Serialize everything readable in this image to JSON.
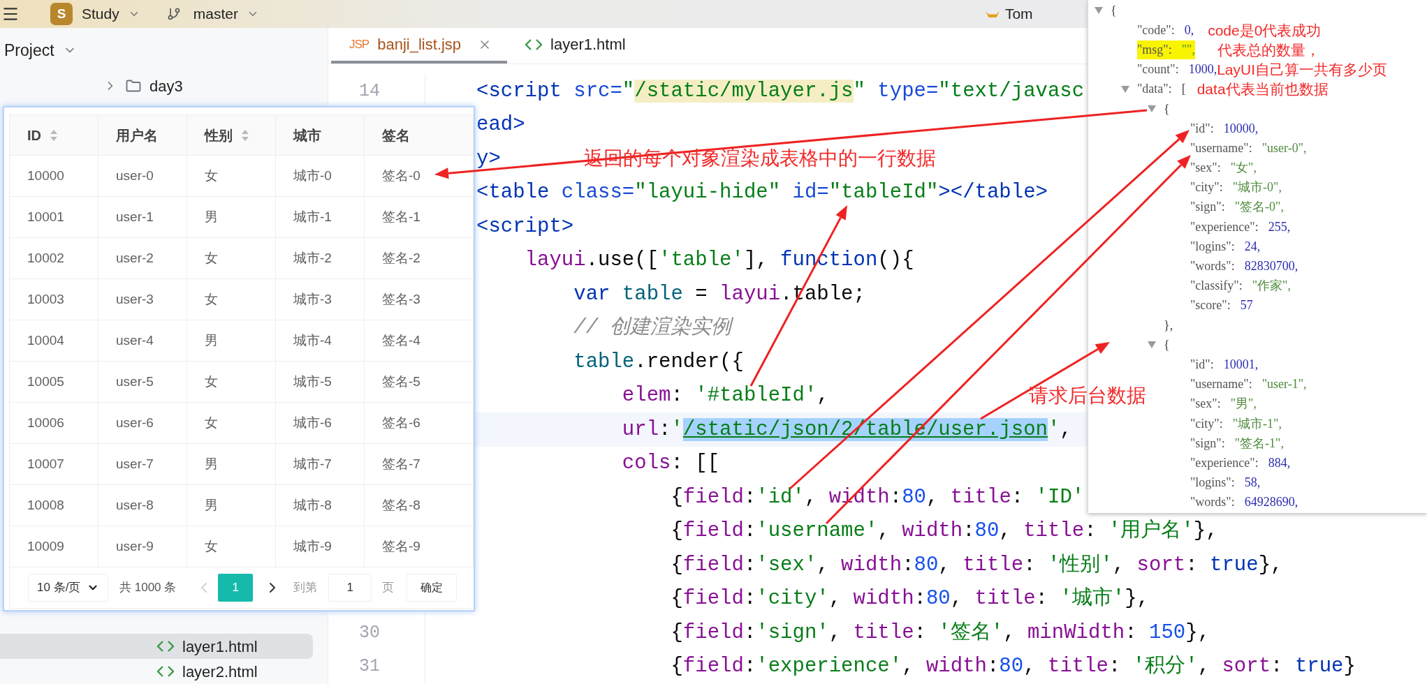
{
  "topbar": {
    "project_badge": "S",
    "project": "Study",
    "branch": "master",
    "run_config": "Tom"
  },
  "sidebar": {
    "title": "Project",
    "items_top": [
      {
        "label": "day3",
        "kind": "folder",
        "expanded": false,
        "selected": false
      }
    ],
    "items_bottom": [
      {
        "label": "layer1.html",
        "kind": "html",
        "selected": true
      },
      {
        "label": "layer2.html",
        "kind": "html",
        "selected": false
      }
    ]
  },
  "editor": {
    "tabs": [
      {
        "label": "banji_list.jsp",
        "kind": "jsp",
        "icon_text": "JSP",
        "selected": true,
        "closable": true
      },
      {
        "label": "layer1.html",
        "kind": "html",
        "selected": false,
        "closable": false
      }
    ],
    "lines": [
      {
        "number": "14",
        "current": false,
        "tokens": [
          {
            "text": "<script",
            "kind": "tag"
          },
          {
            "text": " src=",
            "kind": "attr"
          },
          {
            "text": "\"",
            "kind": "string"
          },
          {
            "text": "/static/mylayer.js",
            "kind": "string_match"
          },
          {
            "text": "\"",
            "kind": "string"
          },
          {
            "text": " type=",
            "kind": "attr"
          },
          {
            "text": "\"text/javasc",
            "kind": "string"
          }
        ]
      },
      {
        "current": false,
        "tokens": [
          {
            "text": "ead>",
            "kind": "tag"
          }
        ]
      },
      {
        "current": false,
        "tokens": [
          {
            "text": "y>",
            "kind": "tag"
          }
        ],
        "note": "返回的每个对象渲染成表格中的一行数据"
      },
      {
        "current": false,
        "tokens": [
          {
            "text": "<table",
            "kind": "tag"
          },
          {
            "text": " class=",
            "kind": "attr"
          },
          {
            "text": "\"layui-hide\"",
            "kind": "string"
          },
          {
            "text": " id=",
            "kind": "attr"
          },
          {
            "text": "\"tableId\"",
            "kind": "string"
          },
          {
            "text": "></table>",
            "kind": "tag"
          }
        ]
      },
      {
        "current": false,
        "tokens": [
          {
            "text": "<script>",
            "kind": "tag"
          }
        ]
      },
      {
        "current": false,
        "tokens": [
          {
            "text": "    layui",
            "kind": "ident"
          },
          {
            "text": ".use([",
            "kind": "plain"
          },
          {
            "text": "'table'",
            "kind": "string"
          },
          {
            "text": "], ",
            "kind": "plain"
          },
          {
            "text": "function",
            "kind": "keyword"
          },
          {
            "text": "(){",
            "kind": "plain"
          }
        ]
      },
      {
        "current": false,
        "tokens": [
          {
            "text": "        var",
            "kind": "keyword"
          },
          {
            "text": " table",
            "kind": "variable"
          },
          {
            "text": " = ",
            "kind": "plain"
          },
          {
            "text": "layui",
            "kind": "ident"
          },
          {
            "text": ".table;",
            "kind": "plain"
          }
        ]
      },
      {
        "current": false,
        "tokens": [
          {
            "text": "        // 创建渲染实例",
            "kind": "comment"
          }
        ]
      },
      {
        "current": false,
        "tokens": [
          {
            "text": "        table",
            "kind": "variable"
          },
          {
            "text": ".render({",
            "kind": "plain"
          }
        ]
      },
      {
        "current": false,
        "tokens": [
          {
            "text": "            elem",
            "kind": "ident"
          },
          {
            "text": ": ",
            "kind": "plain"
          },
          {
            "text": "'#tableId'",
            "kind": "string"
          },
          {
            "text": ",",
            "kind": "plain"
          }
        ],
        "note": "请求后台数据"
      },
      {
        "current": true,
        "tokens": [
          {
            "text": "            url",
            "kind": "ident"
          },
          {
            "text": ":",
            "kind": "plain"
          },
          {
            "text": "'",
            "kind": "string"
          },
          {
            "text": "/static/json/2/table/user.json",
            "kind": "string_selected"
          },
          {
            "text": "'",
            "kind": "string"
          },
          {
            "text": ",",
            "kind": "plain"
          }
        ]
      },
      {
        "current": false,
        "tokens": [
          {
            "text": "            cols",
            "kind": "ident"
          },
          {
            "text": ": [[",
            "kind": "plain"
          }
        ]
      },
      {
        "current": false,
        "tokens": [
          {
            "text": "                {",
            "kind": "plain"
          },
          {
            "text": "field",
            "kind": "ident"
          },
          {
            "text": ":",
            "kind": "plain"
          },
          {
            "text": "'id'",
            "kind": "string"
          },
          {
            "text": ", ",
            "kind": "plain"
          },
          {
            "text": "width",
            "kind": "ident"
          },
          {
            "text": ":",
            "kind": "plain"
          },
          {
            "text": "80",
            "kind": "number"
          },
          {
            "text": ", ",
            "kind": "plain"
          },
          {
            "text": "title",
            "kind": "ident"
          },
          {
            "text": ": ",
            "kind": "plain"
          },
          {
            "text": "'ID'",
            "kind": "string"
          }
        ]
      },
      {
        "current": false,
        "tokens": [
          {
            "text": "                {",
            "kind": "plain"
          },
          {
            "text": "field",
            "kind": "ident"
          },
          {
            "text": ":",
            "kind": "plain"
          },
          {
            "text": "'username'",
            "kind": "string"
          },
          {
            "text": ", ",
            "kind": "plain"
          },
          {
            "text": "width",
            "kind": "ident"
          },
          {
            "text": ":",
            "kind": "plain"
          },
          {
            "text": "80",
            "kind": "number"
          },
          {
            "text": ", ",
            "kind": "plain"
          },
          {
            "text": "title",
            "kind": "ident"
          },
          {
            "text": ": ",
            "kind": "plain"
          },
          {
            "text": "'用户名'",
            "kind": "string"
          },
          {
            "text": "},",
            "kind": "plain"
          }
        ]
      },
      {
        "current": false,
        "tokens": [
          {
            "text": "                {",
            "kind": "plain"
          },
          {
            "text": "field",
            "kind": "ident"
          },
          {
            "text": ":",
            "kind": "plain"
          },
          {
            "text": "'sex'",
            "kind": "string"
          },
          {
            "text": ", ",
            "kind": "plain"
          },
          {
            "text": "width",
            "kind": "ident"
          },
          {
            "text": ":",
            "kind": "plain"
          },
          {
            "text": "80",
            "kind": "number"
          },
          {
            "text": ", ",
            "kind": "plain"
          },
          {
            "text": "title",
            "kind": "ident"
          },
          {
            "text": ": ",
            "kind": "plain"
          },
          {
            "text": "'性别'",
            "kind": "string"
          },
          {
            "text": ", ",
            "kind": "plain"
          },
          {
            "text": "sort",
            "kind": "ident"
          },
          {
            "text": ": ",
            "kind": "plain"
          },
          {
            "text": "true",
            "kind": "keyword"
          },
          {
            "text": "},",
            "kind": "plain"
          }
        ]
      },
      {
        "current": false,
        "tokens": [
          {
            "text": "                {",
            "kind": "plain"
          },
          {
            "text": "field",
            "kind": "ident"
          },
          {
            "text": ":",
            "kind": "plain"
          },
          {
            "text": "'city'",
            "kind": "string"
          },
          {
            "text": ", ",
            "kind": "plain"
          },
          {
            "text": "width",
            "kind": "ident"
          },
          {
            "text": ":",
            "kind": "plain"
          },
          {
            "text": "80",
            "kind": "number"
          },
          {
            "text": ", ",
            "kind": "plain"
          },
          {
            "text": "title",
            "kind": "ident"
          },
          {
            "text": ": ",
            "kind": "plain"
          },
          {
            "text": "'城市'",
            "kind": "string"
          },
          {
            "text": "},",
            "kind": "plain"
          }
        ]
      },
      {
        "number": "30",
        "current": false,
        "tokens": [
          {
            "text": "                {",
            "kind": "plain"
          },
          {
            "text": "field",
            "kind": "ident"
          },
          {
            "text": ":",
            "kind": "plain"
          },
          {
            "text": "'sign'",
            "kind": "string"
          },
          {
            "text": ", ",
            "kind": "plain"
          },
          {
            "text": "title",
            "kind": "ident"
          },
          {
            "text": ": ",
            "kind": "plain"
          },
          {
            "text": "'签名'",
            "kind": "string"
          },
          {
            "text": ", ",
            "kind": "plain"
          },
          {
            "text": "minWidth",
            "kind": "ident"
          },
          {
            "text": ": ",
            "kind": "plain"
          },
          {
            "text": "150",
            "kind": "number"
          },
          {
            "text": "},",
            "kind": "plain"
          }
        ]
      },
      {
        "number": "31",
        "current": false,
        "tokens": [
          {
            "text": "                {",
            "kind": "plain"
          },
          {
            "text": "field",
            "kind": "ident"
          },
          {
            "text": ":",
            "kind": "plain"
          },
          {
            "text": "'experience'",
            "kind": "string"
          },
          {
            "text": ", ",
            "kind": "plain"
          },
          {
            "text": "width",
            "kind": "ident"
          },
          {
            "text": ":",
            "kind": "plain"
          },
          {
            "text": "80",
            "kind": "number"
          },
          {
            "text": ", ",
            "kind": "plain"
          },
          {
            "text": "title",
            "kind": "ident"
          },
          {
            "text": ": ",
            "kind": "plain"
          },
          {
            "text": "'积分'",
            "kind": "string"
          },
          {
            "text": ", ",
            "kind": "plain"
          },
          {
            "text": "sort",
            "kind": "ident"
          },
          {
            "text": ": ",
            "kind": "plain"
          },
          {
            "text": "true",
            "kind": "keyword"
          },
          {
            "text": "}",
            "kind": "plain"
          }
        ]
      }
    ]
  },
  "table_window": {
    "columns": [
      {
        "label": "ID",
        "sortable": true
      },
      {
        "label": "用户名",
        "sortable": false
      },
      {
        "label": "性别",
        "sortable": true
      },
      {
        "label": "城市",
        "sortable": false
      },
      {
        "label": "签名",
        "sortable": false
      }
    ],
    "rows": [
      [
        "10000",
        "user-0",
        "女",
        "城市-0",
        "签名-0"
      ],
      [
        "10001",
        "user-1",
        "男",
        "城市-1",
        "签名-1"
      ],
      [
        "10002",
        "user-2",
        "女",
        "城市-2",
        "签名-2"
      ],
      [
        "10003",
        "user-3",
        "女",
        "城市-3",
        "签名-3"
      ],
      [
        "10004",
        "user-4",
        "男",
        "城市-4",
        "签名-4"
      ],
      [
        "10005",
        "user-5",
        "女",
        "城市-5",
        "签名-5"
      ],
      [
        "10006",
        "user-6",
        "女",
        "城市-6",
        "签名-6"
      ],
      [
        "10007",
        "user-7",
        "男",
        "城市-7",
        "签名-7"
      ],
      [
        "10008",
        "user-8",
        "男",
        "城市-8",
        "签名-8"
      ],
      [
        "10009",
        "user-9",
        "女",
        "城市-9",
        "签名-9"
      ]
    ],
    "pager": {
      "page_size": "10 条/页",
      "total": "共 1000 条",
      "prev_disabled": true,
      "pages": [
        {
          "label": "1",
          "selected": true
        }
      ],
      "next_disabled": false,
      "goto_label": "到第",
      "goto_value": "1",
      "page_unit": "页",
      "confirm": "确定"
    }
  },
  "json_viewer": {
    "open": "{",
    "expanded": true,
    "children": [
      {
        "key": "\"code\":",
        "value": "0,",
        "kind": "number",
        "highlighted": false,
        "note": "code是0代表成功"
      },
      {
        "key": "\"msg\":",
        "value": "\"\",",
        "kind": "string",
        "highlighted": true,
        "note": "代表总的数量，"
      },
      {
        "key": "\"count\":",
        "value": "1000,",
        "kind": "number",
        "highlighted": false,
        "note": "LayUI自己算一共有多少页"
      },
      {
        "key": "\"data\":",
        "value": "[",
        "kind": "bracket",
        "highlighted": false,
        "note": "data代表当前也数据",
        "expanded": true,
        "children": [
          {
            "open": "{",
            "expanded": true,
            "close": "},",
            "children": [
              {
                "key": "\"id\":",
                "value": "10000,",
                "kind": "number",
                "highlighted": false
              },
              {
                "key": "\"username\":",
                "value": "\"user-0\",",
                "kind": "string",
                "highlighted": false
              },
              {
                "key": "\"sex\":",
                "value": "\"女\",",
                "kind": "string",
                "highlighted": false
              },
              {
                "key": "\"city\":",
                "value": "\"城市-0\",",
                "kind": "string",
                "highlighted": false
              },
              {
                "key": "\"sign\":",
                "value": "\"签名-0\",",
                "kind": "string",
                "highlighted": false
              },
              {
                "key": "\"experience\":",
                "value": "255,",
                "kind": "number",
                "highlighted": false
              },
              {
                "key": "\"logins\":",
                "value": "24,",
                "kind": "number",
                "highlighted": false
              },
              {
                "key": "\"words\":",
                "value": "82830700,",
                "kind": "number",
                "highlighted": false
              },
              {
                "key": "\"classify\":",
                "value": "\"作家\",",
                "kind": "string",
                "highlighted": false
              },
              {
                "key": "\"score\":",
                "value": "57",
                "kind": "number",
                "highlighted": false
              }
            ]
          },
          {
            "open": "{",
            "expanded": true,
            "children": [
              {
                "key": "\"id\":",
                "value": "10001,",
                "kind": "number",
                "highlighted": false
              },
              {
                "key": "\"username\":",
                "value": "\"user-1\",",
                "kind": "string",
                "highlighted": false
              },
              {
                "key": "\"sex\":",
                "value": "\"男\",",
                "kind": "string",
                "highlighted": false
              },
              {
                "key": "\"city\":",
                "value": "\"城市-1\",",
                "kind": "string",
                "highlighted": false
              },
              {
                "key": "\"sign\":",
                "value": "\"签名-1\",",
                "kind": "string",
                "highlighted": false
              },
              {
                "key": "\"experience\":",
                "value": "884,",
                "kind": "number",
                "highlighted": false
              },
              {
                "key": "\"logins\":",
                "value": "58,",
                "kind": "number",
                "highlighted": false
              },
              {
                "key": "\"words\":",
                "value": "64928690,",
                "kind": "number",
                "highlighted": false
              }
            ]
          }
        ]
      }
    ]
  }
}
